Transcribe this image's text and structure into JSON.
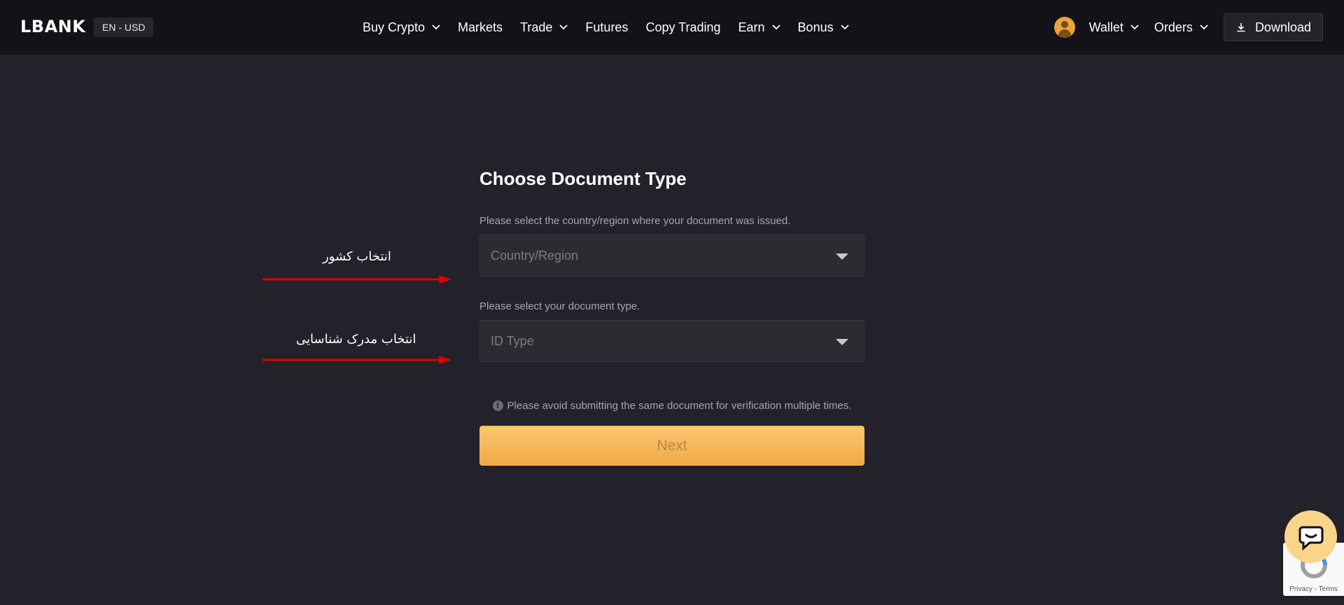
{
  "header": {
    "logo": "LBANK",
    "lang_currency": "EN - USD",
    "nav": [
      {
        "label": "Buy Crypto",
        "dropdown": true
      },
      {
        "label": "Markets",
        "dropdown": false
      },
      {
        "label": "Trade",
        "dropdown": true
      },
      {
        "label": "Futures",
        "dropdown": false
      },
      {
        "label": "Copy Trading",
        "dropdown": false
      },
      {
        "label": "Earn",
        "dropdown": true
      },
      {
        "label": "Bonus",
        "dropdown": true
      }
    ],
    "wallet_label": "Wallet",
    "orders_label": "Orders",
    "download_label": "Download"
  },
  "form": {
    "title": "Choose Document Type",
    "country_hint": "Please select the country/region where your document was issued.",
    "country_placeholder": "Country/Region",
    "doc_hint": "Please select your document type.",
    "doc_placeholder": "ID Type",
    "notice": "Please avoid submitting the same document for verification multiple times.",
    "next_label": "Next"
  },
  "annotations": {
    "country": "انتخاب کشور",
    "document": "انتخاب مدرک شناسایی",
    "arrow_color": "#e00000"
  },
  "recaptcha": {
    "text": "Privacy - Terms"
  },
  "colors": {
    "accent": "#f0a945",
    "background": "#232129",
    "header": "#131217"
  }
}
